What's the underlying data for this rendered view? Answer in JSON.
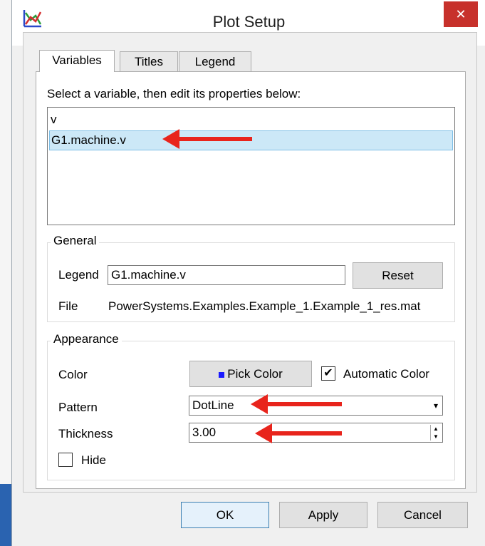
{
  "window": {
    "title": "Plot Setup",
    "close_glyph": "✕",
    "icon": "plot-icon"
  },
  "tabs": [
    {
      "label": "Variables",
      "active": true
    },
    {
      "label": "Titles",
      "active": false
    },
    {
      "label": "Legend",
      "active": false
    }
  ],
  "variables": {
    "instruction": "Select a variable, then edit its properties below:",
    "items": [
      {
        "label": "v",
        "selected": false
      },
      {
        "label": "G1.machine.v",
        "selected": true
      }
    ]
  },
  "general": {
    "title": "General",
    "legend_label": "Legend",
    "legend_value": "G1.machine.v",
    "reset_label": "Reset",
    "file_label": "File",
    "file_value": "PowerSystems.Examples.Example_1.Example_1_res.mat"
  },
  "appearance": {
    "title": "Appearance",
    "color_label": "Color",
    "pick_color_label": "Pick Color",
    "swatch_color": "#1a1aff",
    "automatic_color_label": "Automatic Color",
    "automatic_color_checked": true,
    "pattern_label": "Pattern",
    "pattern_value": "DotLine",
    "thickness_label": "Thickness",
    "thickness_value": "3.00",
    "hide_label": "Hide",
    "hide_checked": false
  },
  "buttons": {
    "ok": "OK",
    "apply": "Apply",
    "cancel": "Cancel"
  },
  "annotation_color": "#e8241c"
}
